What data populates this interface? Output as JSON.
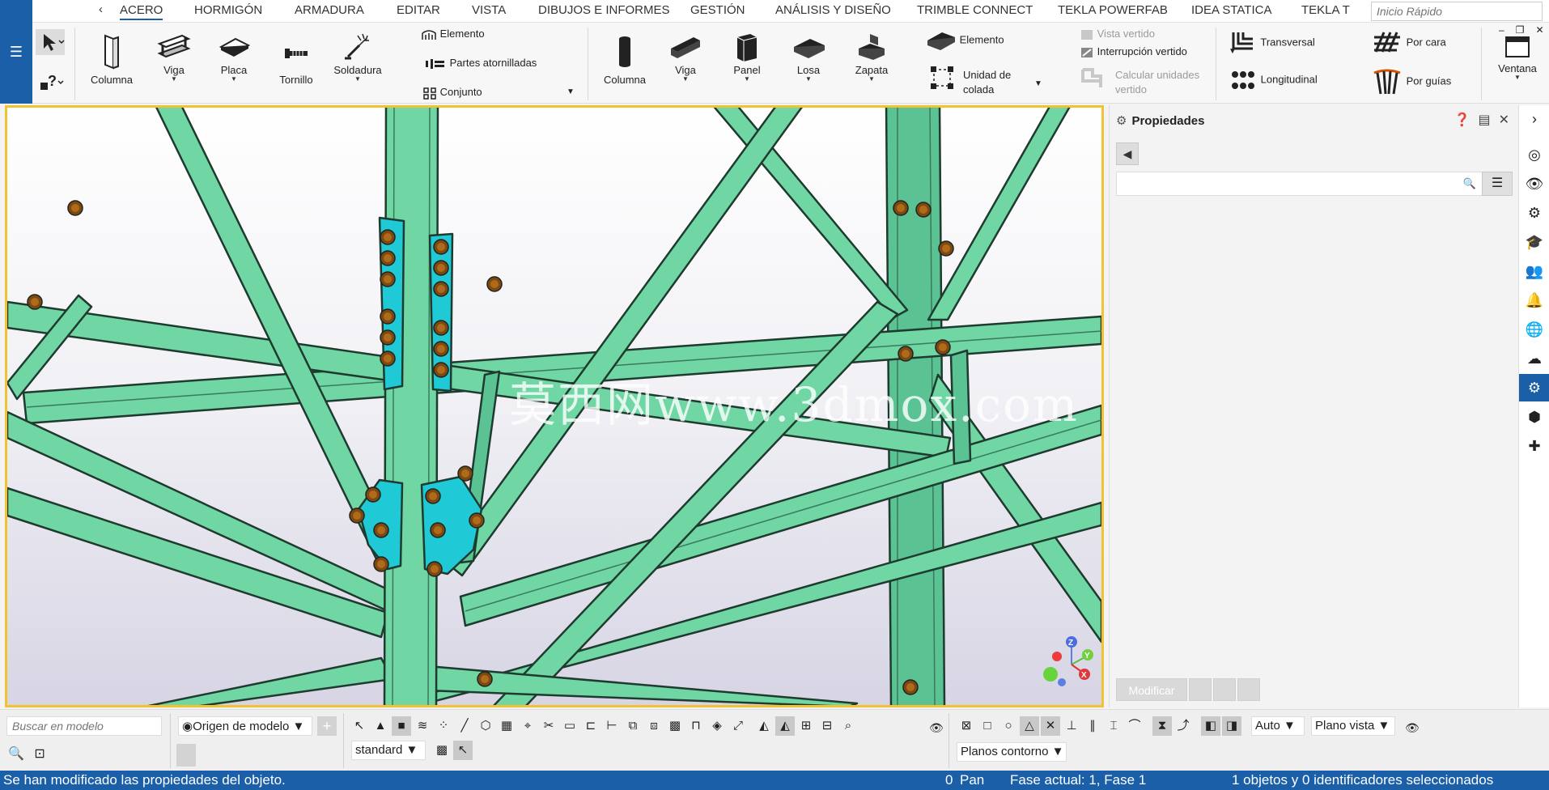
{
  "tabs": {
    "prev": "‹",
    "items": [
      "ACERO",
      "HORMIGÓN",
      "ARMADURA",
      "EDITAR",
      "VISTA",
      "DIBUJOS E INFORMES",
      "GESTIÓN",
      "ANÁLISIS Y DISEÑO",
      "TRIMBLE CONNECT",
      "TEKLA POWERFAB",
      "IDEA STATICA",
      "TEKLA T"
    ],
    "active_index": 0
  },
  "quick_launch": {
    "placeholder": "Inicio Rápido"
  },
  "ribbon": {
    "steel": {
      "columna": "Columna",
      "viga": "Viga",
      "placa": "Placa",
      "tornillo": "Tornillo",
      "soldadura": "Soldadura",
      "elemento": "Elemento",
      "partes_atornilladas": "Partes atornilladas",
      "conjunto": "Conjunto"
    },
    "concrete": {
      "columna": "Columna",
      "viga": "Viga",
      "panel": "Panel",
      "losa": "Losa",
      "zapata": "Zapata",
      "elemento": "Elemento",
      "unidad_de": "Unidad de",
      "colada": "colada",
      "vista_vertido": "Vista vertido",
      "interrupcion_vertido": "Interrupción vertido",
      "calcular_unidades": "Calcular unidades",
      "vertido": "vertido"
    },
    "rebar": {
      "transversal": "Transversal",
      "longitudinal": "Longitudinal",
      "por_cara": "Por cara",
      "por_guias": "Por guías"
    },
    "window": {
      "ventana": "Ventana"
    }
  },
  "viewport": {
    "watermark": "莫西网www.3dmox.com",
    "axes": {
      "z": "Z",
      "y": "Y",
      "x": "X"
    }
  },
  "properties": {
    "title": "Propiedades",
    "modify": "Modificar"
  },
  "bottom": {
    "search_placeholder": "Buscar en modelo",
    "origin": "Origen de modelo",
    "standard": "standard",
    "auto": "Auto",
    "plano_vista": "Plano vista",
    "planos_contorno": "Planos contorno"
  },
  "status": {
    "message": "Se han modificado las propiedades del objeto.",
    "counter": "0",
    "mode": "Pan",
    "phase": "Fase actual: 1, Fase 1",
    "selection": "1 objetos y 0 identificadores seleccionados"
  },
  "colors": {
    "accent": "#1a5fa8",
    "steel_member": "#6fd6a4",
    "plate": "#1fc9d6",
    "bolt": "#9a5a12",
    "viewport_border": "#f1c232"
  }
}
